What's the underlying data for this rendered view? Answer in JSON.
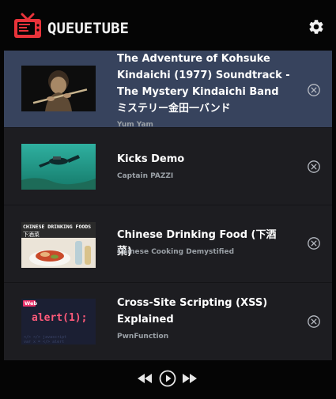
{
  "app": {
    "name": "QUEUETUBE",
    "accent": "#e8333a"
  },
  "queue": [
    {
      "title": "The Adventure of Kohsuke Kindaichi (1977) Soundtrack - The Mystery Kindaichi Band ミステリー金田一バンド",
      "channel": "Yum Yam",
      "active": true,
      "thumbnail": "man-playing-flute"
    },
    {
      "title": "Kicks Demo",
      "channel": "Captain PAZZI",
      "active": false,
      "thumbnail": "scuba-diver-underwater"
    },
    {
      "title": "Chinese Drinking Food (下酒菜)",
      "channel": "Chinese Cooking Demystified",
      "active": false,
      "thumbnail": "dish-with-bottles",
      "thumbnail_text": [
        "CHINESE DRINKING FOODS",
        "下酒菜"
      ]
    },
    {
      "title": "Cross-Site Scripting (XSS) Explained",
      "channel": "PwnFunction",
      "active": false,
      "thumbnail": "code-alert-screen",
      "thumbnail_text": [
        "Web",
        "alert(1);"
      ]
    }
  ],
  "colors": {
    "active_row": "#37435d",
    "row": "#1d1d21",
    "channel_text": "#9aa0a6"
  },
  "icons": {
    "settings": "gear-icon",
    "remove": "close-circle-icon",
    "previous": "rewind-icon",
    "play": "play-circle-icon",
    "next": "fast-forward-icon"
  }
}
